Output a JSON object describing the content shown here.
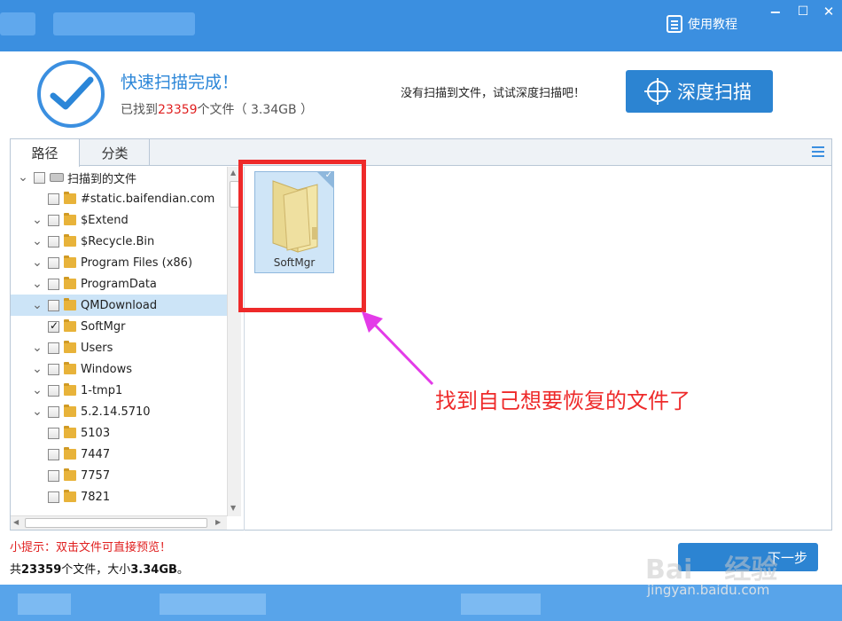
{
  "window": {
    "tutorial_label": "使用教程",
    "min_symbol": "−",
    "max_symbol": "☐",
    "close_symbol": "✕"
  },
  "header": {
    "title": "快速扫描完成！",
    "found_prefix": "已找到",
    "found_count": "23359",
    "found_suffix": "个文件（ 3.34GB ）",
    "deep_hint": "没有扫描到文件，试试深度扫描吧！",
    "deep_button": "深度扫描"
  },
  "tabs": [
    {
      "label": "路径",
      "active": true
    },
    {
      "label": "分类",
      "active": false
    }
  ],
  "tree": [
    {
      "label": "扫描到的文件",
      "level": 0,
      "expanded": true,
      "icon": "drive-icon",
      "checked": false,
      "selected": false
    },
    {
      "label": "#static.baifendian.com",
      "level": 1,
      "expanded": false,
      "icon": "folder-icon",
      "checked": false,
      "selected": false
    },
    {
      "label": "$Extend",
      "level": 1,
      "expanded": true,
      "icon": "folder-icon",
      "checked": false,
      "selected": false
    },
    {
      "label": "$Recycle.Bin",
      "level": 1,
      "expanded": true,
      "icon": "folder-icon",
      "checked": false,
      "selected": false
    },
    {
      "label": "Program Files (x86)",
      "level": 1,
      "expanded": true,
      "icon": "folder-icon",
      "checked": false,
      "selected": false
    },
    {
      "label": "ProgramData",
      "level": 1,
      "expanded": true,
      "icon": "folder-icon",
      "checked": false,
      "selected": false
    },
    {
      "label": "QMDownload",
      "level": 1,
      "expanded": true,
      "icon": "folder-icon",
      "checked": false,
      "selected": true
    },
    {
      "label": "SoftMgr",
      "level": 2,
      "expanded": false,
      "icon": "folder-icon",
      "checked": true,
      "selected": false
    },
    {
      "label": "Users",
      "level": 1,
      "expanded": true,
      "icon": "folder-icon",
      "checked": false,
      "selected": false
    },
    {
      "label": "Windows",
      "level": 1,
      "expanded": true,
      "icon": "folder-icon",
      "checked": false,
      "selected": false
    },
    {
      "label": "1-tmp1",
      "level": 1,
      "expanded": true,
      "icon": "folder-icon",
      "checked": false,
      "selected": false
    },
    {
      "label": "5.2.14.5710",
      "level": 1,
      "expanded": true,
      "icon": "folder-icon",
      "checked": false,
      "selected": false
    },
    {
      "label": "5103",
      "level": 1,
      "expanded": false,
      "icon": "folder-icon",
      "checked": false,
      "selected": false
    },
    {
      "label": "7447",
      "level": 1,
      "expanded": false,
      "icon": "folder-icon",
      "checked": false,
      "selected": false
    },
    {
      "label": "7757",
      "level": 1,
      "expanded": false,
      "icon": "folder-icon",
      "checked": false,
      "selected": false
    },
    {
      "label": "7821",
      "level": 1,
      "expanded": false,
      "icon": "folder-icon",
      "checked": false,
      "selected": false
    }
  ],
  "file_view": {
    "items": [
      {
        "label": "SoftMgr",
        "icon": "folder-icon",
        "checked": true
      }
    ]
  },
  "annotation": {
    "text": "找到自己想要恢复的文件了",
    "color": "#ee2a2a"
  },
  "footer": {
    "tip": "小提示：双击文件可直接预览！",
    "summary_prefix": "共",
    "summary_count": "23359",
    "summary_middle": "个文件，大小",
    "summary_size": "3.34GB",
    "summary_suffix": "。",
    "next_button": "下一步"
  },
  "watermark": {
    "brand": "Bai",
    "brand_tail": "经验",
    "url": "jingyan.baidu.com"
  },
  "colors": {
    "accent": "#3b8fe0",
    "button": "#2c84d2",
    "highlight_red": "#e02020",
    "selection": "#cce4f7"
  }
}
